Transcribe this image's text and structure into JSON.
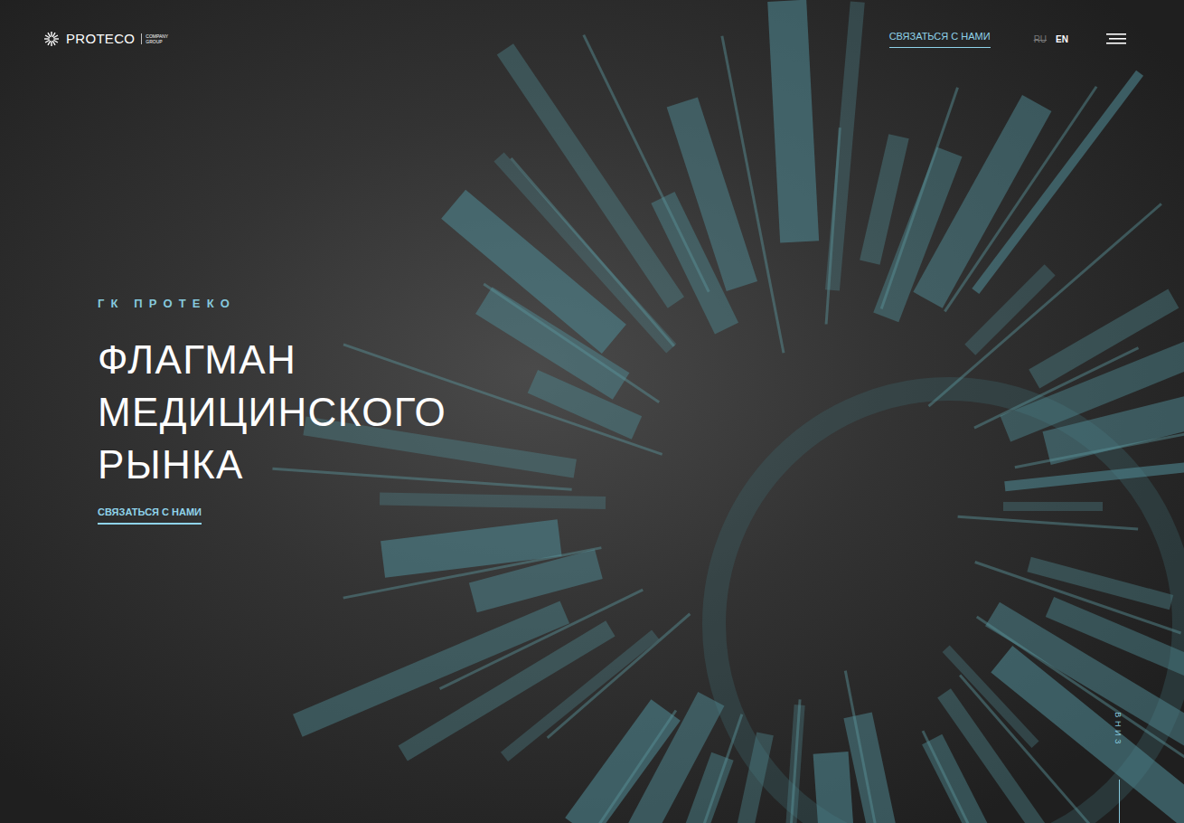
{
  "header": {
    "logo": {
      "name": "PROTECO",
      "subtitle": [
        "COMPANY",
        "GROUP"
      ]
    },
    "contact_link": "СВЯЗАТЬСЯ С НАМИ",
    "languages": [
      {
        "label": "RU",
        "selected": true
      },
      {
        "label": "EN",
        "selected": false
      }
    ]
  },
  "hero": {
    "eyebrow": "ГК ПРОТЕКО",
    "title_lines": [
      "ФЛАГМАН",
      "МЕДИЦИНСКОГО",
      "РЫНКА"
    ],
    "button": "СВЯЗАТЬСЯ С НАМИ"
  },
  "scroll_hint": "ВНИЗ"
}
